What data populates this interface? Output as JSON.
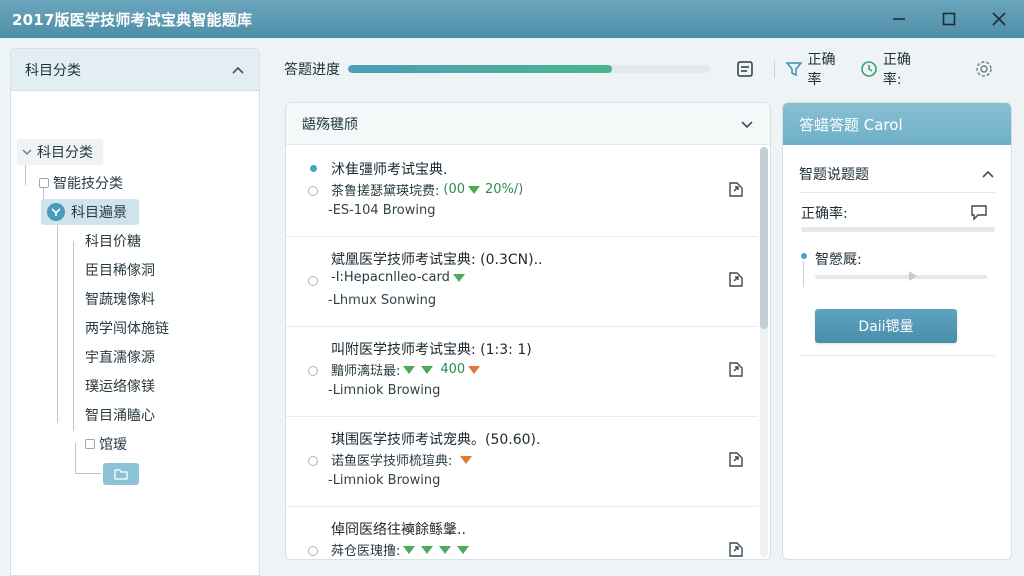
{
  "window": {
    "title": "2017版医学技师考试宝典智能题库"
  },
  "sidebar": {
    "header": "科目分类",
    "root_label": "科目分类",
    "items": [
      {
        "label": "智能技分类"
      },
      {
        "label": "科目遍景"
      },
      {
        "label": "科目价糖"
      },
      {
        "label": "臣目稀傢洞"
      },
      {
        "label": "智蔬瑰像料"
      },
      {
        "label": "两学闯体施链"
      },
      {
        "label": "宇直濡傢源"
      },
      {
        "label": "璞运络傢镁"
      },
      {
        "label": "智目涌瞌心"
      },
      {
        "label": "馆瑷"
      }
    ]
  },
  "progress": {
    "label": "答题进度",
    "value_percent": 73
  },
  "toolbar": {
    "item1_label": "正确率",
    "item2_label": "正确率:"
  },
  "question_panel": {
    "header": "龉殇毽颀",
    "items": [
      {
        "title": "沭隹彊师考试宝典.",
        "line2_prefix": "茶鲁搓瑟黛瑛垸费:",
        "stat1": "(00",
        "stat2": "20%/)",
        "author": "-ES-104 Browing"
      },
      {
        "title": "斌凰医学技师考试宝典: (0.3CN)..",
        "line2_prefix": "-I:Hepacnlleo-card",
        "author": "-Lhmux Sonwing"
      },
      {
        "title": "叫附医学技师考试宝典: (1:3: 1)",
        "line2_prefix": "黯师漓琺最:",
        "stat1": "400",
        "author": "-Limniok Browing"
      },
      {
        "title": "琪围医学技师考试宠典。(50.60).",
        "line2_prefix": "诺鱼医学技师梳瑄典:",
        "author": "-Limniok Browing"
      },
      {
        "title": "倬冏医络往襫餘鲧鞶..",
        "line2_prefix": "荈仓医瑰撸:",
        "author": ""
      }
    ]
  },
  "right_panel": {
    "header": "答蜡答题 Carol",
    "sub_header": "智题说题题",
    "row1_label": "正确率:",
    "row2_label": "智憥厩:",
    "button_label": "Daii锶量"
  },
  "colors": {
    "titlebar": "#5a98b1",
    "accent": "#4f9dbb",
    "green": "#4bab5a",
    "orange": "#e07b3a"
  }
}
